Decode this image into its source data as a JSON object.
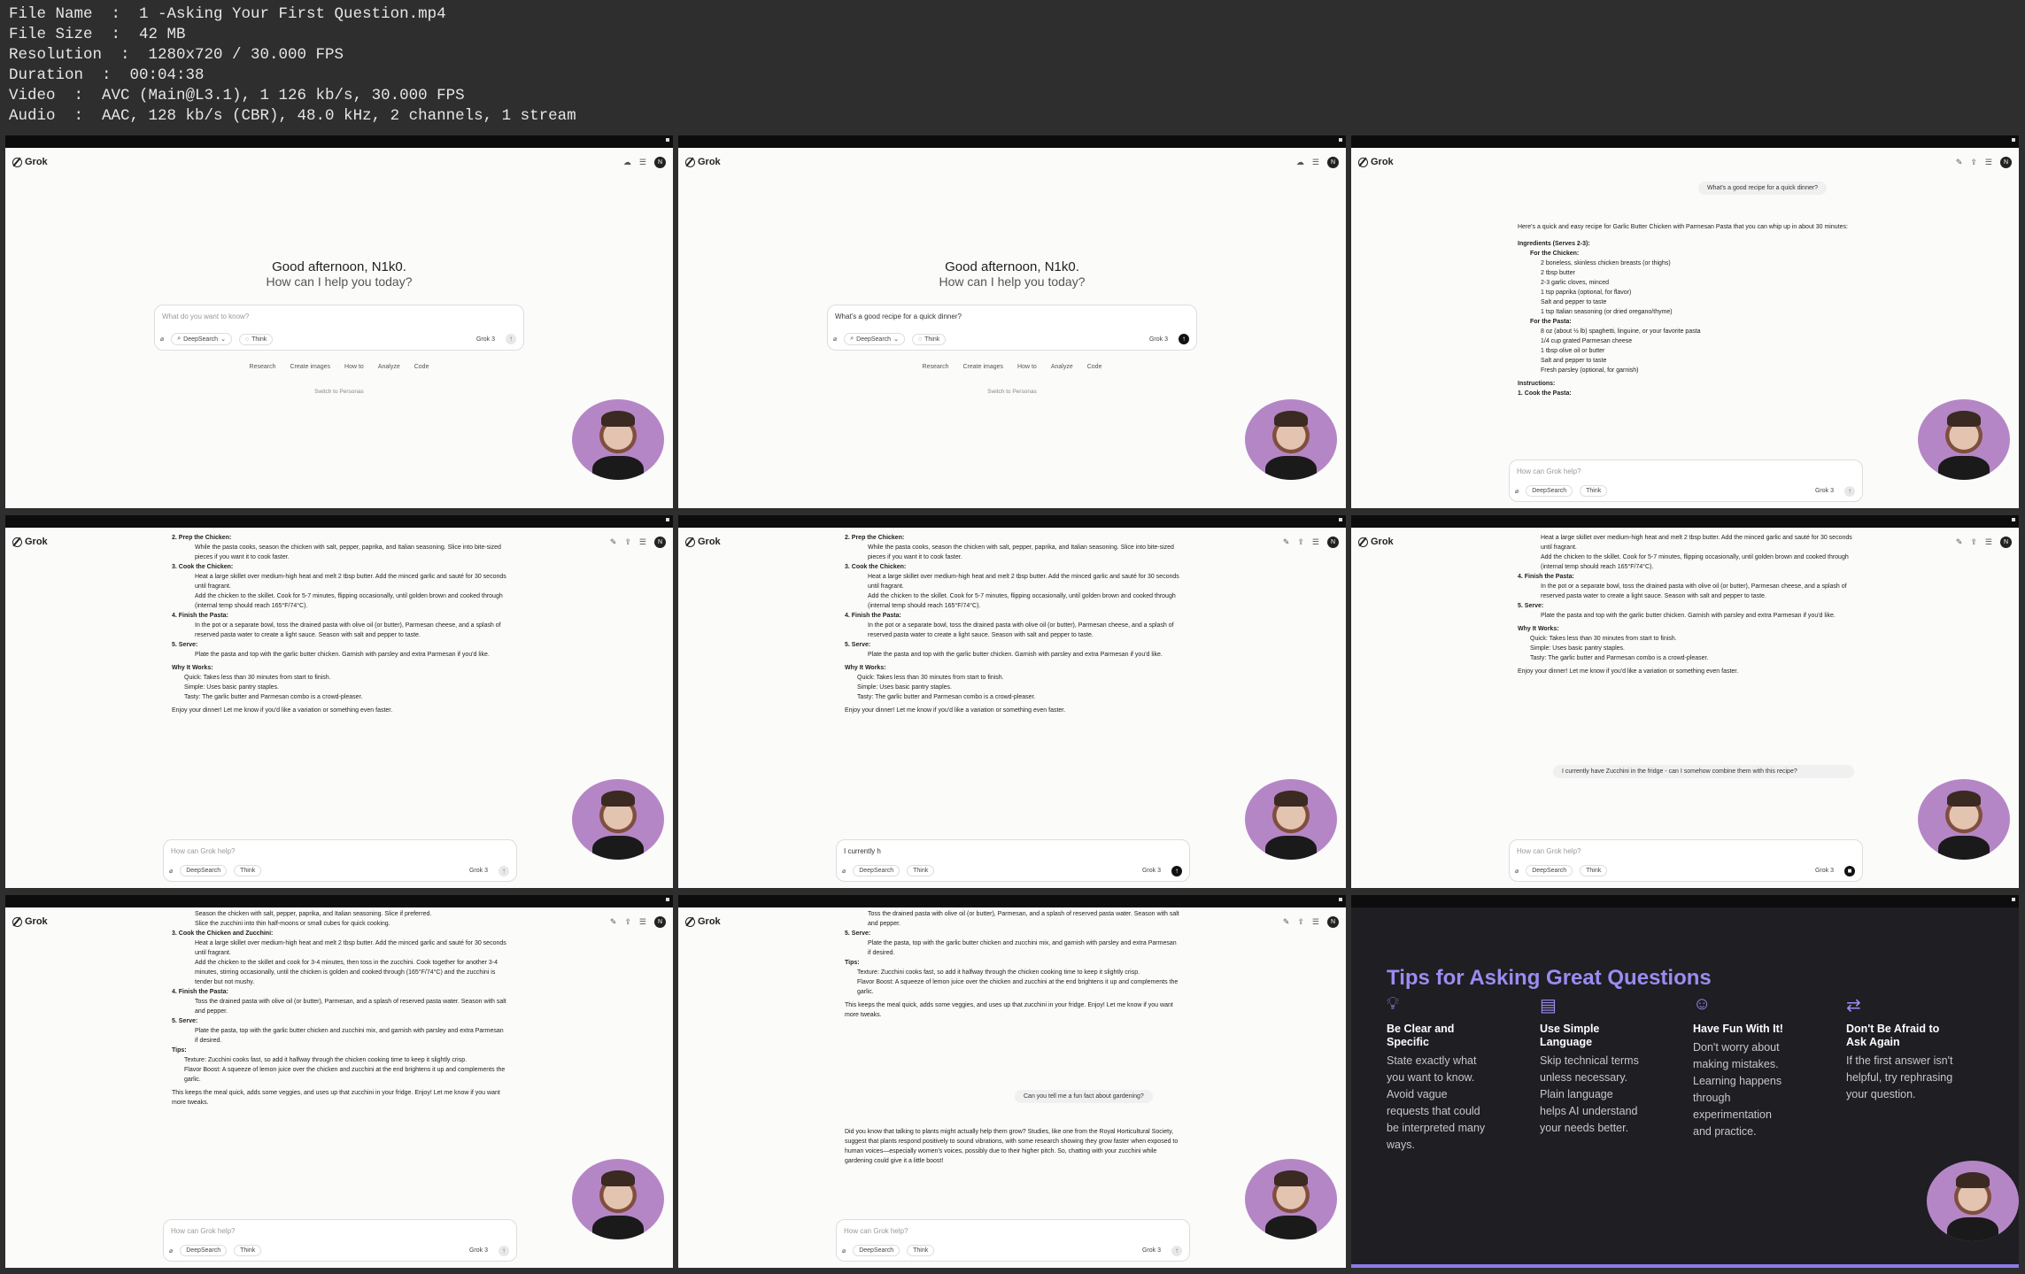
{
  "info": {
    "file_name": "File Name  :  1 -Asking Your First Question.mp4",
    "file_size": "File Size  :  42 MB",
    "resolution": "Resolution  :  1280x720 / 30.000 FPS",
    "duration": "Duration  :  00:04:38",
    "video": "Video  :  AVC (Main@L3.1), 1 126 kb/s, 30.000 FPS",
    "audio": "Audio  :  AAC, 128 kb/s (CBR), 48.0 kHz, 2 channels, 1 stream"
  },
  "app": {
    "logo": "Grok",
    "avatar": "N"
  },
  "greeting": {
    "line1": "Good afternoon, N1k0.",
    "line2": "How can I help you today?"
  },
  "input": {
    "placeholder_home": "What do you want to know?",
    "typed_question": "What's a good recipe for a quick dinner?",
    "placeholder_chat": "How can Grok help?",
    "typed_partial": "I currently h",
    "deepsearch": "DeepSearch",
    "think": "Think",
    "model": "Grok 3"
  },
  "quick_actions": [
    "Research",
    "Create images",
    "How to",
    "Analyze",
    "Code"
  ],
  "switch_personas": "Switch to Personas",
  "recipe": {
    "question": "What's a good recipe for a quick dinner?",
    "intro": "Here's a quick and easy recipe for Garlic Butter Chicken with Parmesan Pasta that you can whip up in about 30 minutes:",
    "ingredients_title": "Ingredients (Serves 2-3):",
    "chicken_title": "For the Chicken:",
    "chicken_items": [
      "2 boneless, skinless chicken breasts (or thighs)",
      "2 tbsp butter",
      "2-3 garlic cloves, minced",
      "1 tsp paprika (optional, for flavor)",
      "Salt and pepper to taste",
      "1 tsp Italian seasoning (or dried oregano/thyme)"
    ],
    "pasta_title": "For the Pasta:",
    "pasta_items": [
      "8 oz (about ½ lb) spaghetti, linguine, or your favorite pasta",
      "1/4 cup grated Parmesan cheese",
      "1 tbsp olive oil or butter",
      "Salt and pepper to taste",
      "Fresh parsley (optional, for garnish)"
    ],
    "instructions_title": "Instructions:",
    "step1": "1.  Cook the Pasta:",
    "step2": "2.  Prep the Chicken:",
    "step2_text": "While the pasta cooks, season the chicken with salt, pepper, paprika, and Italian seasoning. Slice into bite-sized pieces if you want it to cook faster.",
    "step3": "3.  Cook the Chicken:",
    "step3_a": "Heat a large skillet over medium-high heat and melt 2 tbsp butter. Add the minced garlic and sauté for 30 seconds until fragrant.",
    "step3_b": "Add the chicken to the skillet. Cook for 5-7 minutes, flipping occasionally, until golden brown and cooked through (internal temp should reach 165°F/74°C).",
    "step4": "4.  Finish the Pasta:",
    "step4_text": "In the pot or a separate bowl, toss the drained pasta with olive oil (or butter), Parmesan cheese, and a splash of reserved pasta water to create a light sauce. Season with salt and pepper to taste.",
    "step5": "5.  Serve:",
    "step5_text": "Plate the pasta and top with the garlic butter chicken. Garnish with parsley and extra Parmesan if you'd like.",
    "why_title": "Why It Works:",
    "why_items": [
      "Quick: Takes less than 30 minutes from start to finish.",
      "Simple: Uses basic pantry staples.",
      "Tasty: The garlic butter and Parmesan combo is a crowd-pleaser."
    ],
    "outro": "Enjoy your dinner! Let me know if you'd like a variation or something even faster.",
    "zucchini_q": "I currently have Zucchini in the fridge - can I somehow combine them with this recipe?"
  },
  "zucchini": {
    "season": "Season the chicken with salt, pepper, paprika, and Italian seasoning. Slice if preferred.",
    "slice": "Slice the zucchini into thin half-moons or small cubes for quick cooking.",
    "step3": "3.  Cook the Chicken and Zucchini:",
    "step3_a": "Heat a large skillet over medium-high heat and melt 2 tbsp butter. Add the minced garlic and sauté for 30 seconds until fragrant.",
    "step3_b": "Add the chicken to the skillet and cook for 3-4 minutes, then toss in the zucchini. Cook together for another 3-4 minutes, stirring occasionally, until the chicken is golden and cooked through (165°F/74°C) and the zucchini is tender but not mushy.",
    "step4": "4.  Finish the Pasta:",
    "step4_text": "Toss the drained pasta with olive oil (or butter), Parmesan, and a splash of reserved pasta water. Season with salt and pepper.",
    "step5": "5.  Serve:",
    "step5_text": "Plate the pasta, top with the garlic butter chicken and zucchini mix, and garnish with parsley and extra Parmesan if desired.",
    "tips_title": "Tips:",
    "tip1": "Texture: Zucchini cooks fast, so add it halfway through the chicken cooking time to keep it slightly crisp.",
    "tip2": "Flavor Boost: A squeeze of lemon juice over the chicken and zucchini at the end brightens it up and complements the garlic.",
    "outro": "This keeps the meal quick, adds some veggies, and uses up that zucchini in your fridge. Enjoy! Let me know if you want more tweaks.",
    "garden_q": "Can you tell me a fun fact about gardening?",
    "garden_a": "Did you know that talking to plants might actually help them grow? Studies, like one from the Royal Horticultural Society, suggest that plants respond positively to sound vibrations, with some research showing they grow faster when exposed to human voices—especially women's voices, possibly due to their higher pitch. So, chatting with your zucchini while gardening could give it a little boost!"
  },
  "tips": {
    "title": "Tips for Asking Great Questions",
    "cols": [
      {
        "head": "Be Clear and Specific",
        "body": "State exactly what you want to know. Avoid vague requests that could be interpreted many ways."
      },
      {
        "head": "Use Simple Language",
        "body": "Skip technical terms unless necessary. Plain language helps AI understand your needs better."
      },
      {
        "head": "Have Fun With It!",
        "body": "Don't worry about making mistakes. Learning happens through experimentation and practice."
      },
      {
        "head": "Don't Be Afraid to Ask Again",
        "body": "If the first answer isn't helpful, try rephrasing your question."
      }
    ]
  }
}
